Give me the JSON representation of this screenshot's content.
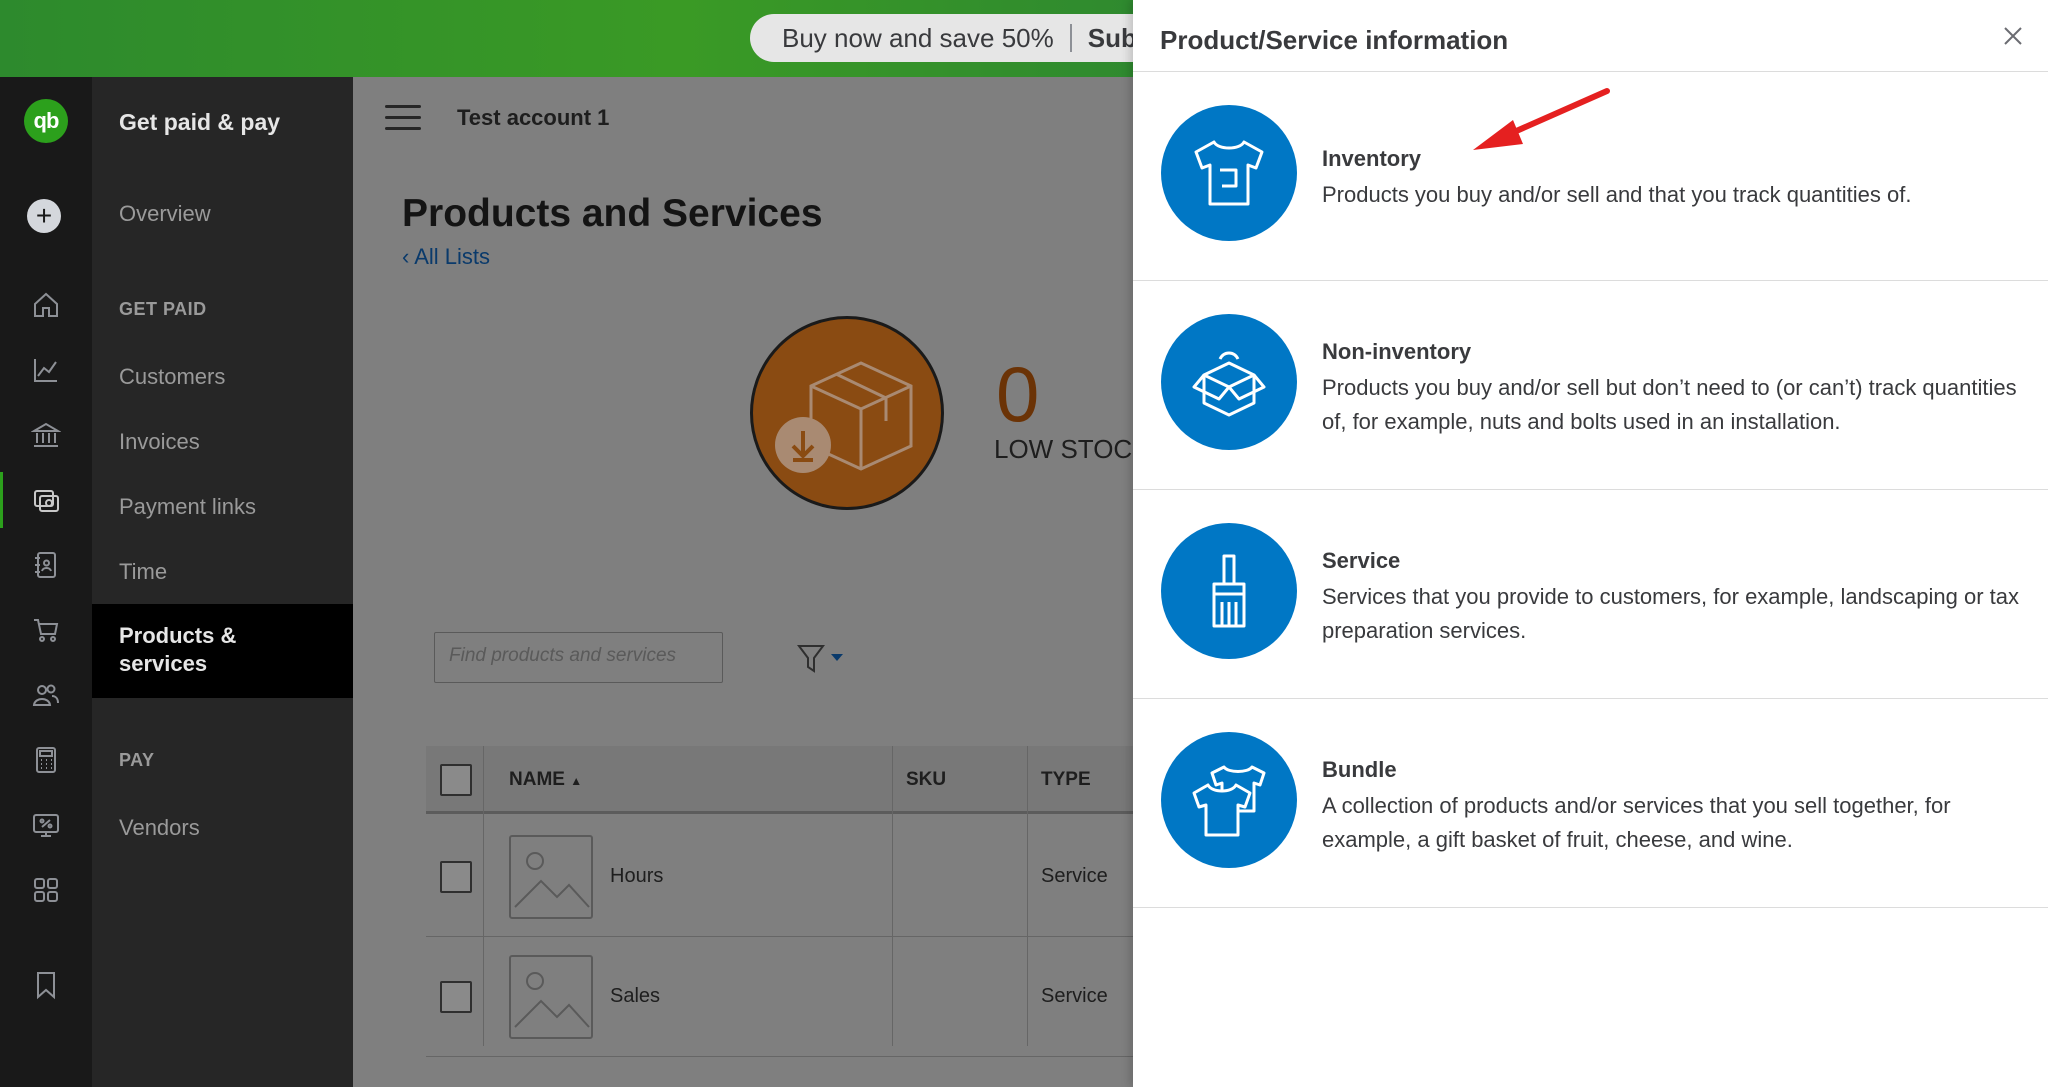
{
  "promo": {
    "text": "Buy now and save 50%",
    "sub_text": "Sub"
  },
  "rail": {
    "logo_text": "qb",
    "items": [
      "home-icon",
      "chart-icon",
      "bank-icon",
      "get-paid-pay-icon",
      "contacts-book-icon",
      "cart-icon",
      "people-icon",
      "calculator-icon",
      "payroll-icon",
      "apps-icon",
      "bookmark-icon"
    ]
  },
  "nav": {
    "title": "Get paid & pay",
    "overview": "Overview",
    "section_get_paid": "GET PAID",
    "customers": "Customers",
    "invoices": "Invoices",
    "payment_links": "Payment links",
    "time": "Time",
    "products_services": "Products & services",
    "section_pay": "PAY",
    "vendors": "Vendors"
  },
  "main": {
    "account": "Test account 1",
    "page_title": "Products and Services",
    "back_link": "All Lists",
    "stock_count": "0",
    "stock_label": "LOW STOCK",
    "search_placeholder": "Find products and services",
    "table": {
      "headers": {
        "name": "NAME",
        "sku": "SKU",
        "type": "TYPE"
      },
      "rows": [
        {
          "name": "Hours",
          "sku": "",
          "type": "Service"
        },
        {
          "name": "Sales",
          "sku": "",
          "type": "Service"
        }
      ]
    }
  },
  "drawer": {
    "title": "Product/Service information",
    "options": [
      {
        "title": "Inventory",
        "description": "Products you buy and/or sell and that you track quantities of.",
        "icon": "tshirt-icon"
      },
      {
        "title": "Non-inventory",
        "description": "Products you buy and/or sell but don’t need to (or can’t) track quantities of, for example, nuts and bolts used in an installation.",
        "icon": "open-box-icon"
      },
      {
        "title": "Service",
        "description": "Services that you provide to customers, for example, landscaping or tax preparation services.",
        "icon": "paintbrush-icon"
      },
      {
        "title": "Bundle",
        "description": "A collection of products and/or services that you sell together, for example, a gift basket of fruit, cheese, and wine.",
        "icon": "stacked-shirts-icon"
      }
    ]
  },
  "colors": {
    "brand_green": "#2ca01c",
    "option_blue": "#0077c5",
    "annotation_red": "#e52020"
  }
}
